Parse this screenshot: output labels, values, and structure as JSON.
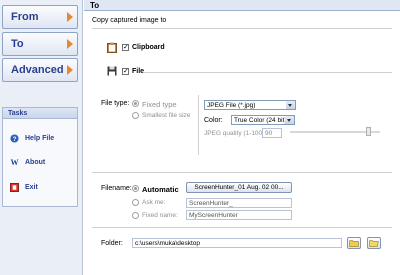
{
  "nav": {
    "from_label": "From",
    "to_label": "To",
    "advanced_label": "Advanced"
  },
  "tasks": {
    "title": "Tasks",
    "items": [
      {
        "label": "Help File",
        "icon": "help-icon"
      },
      {
        "label": "About",
        "icon": "about-icon"
      },
      {
        "label": "Exit",
        "icon": "exit-icon"
      }
    ]
  },
  "panel": {
    "title": "To",
    "subtitle": "Copy captured image to",
    "clipboard_label": "Clipboard",
    "clipboard_checked": true,
    "file_label": "File",
    "file_checked": true
  },
  "file_type": {
    "label": "File type:",
    "fixed_type_label": "Fixed type",
    "smallest_label": "Smallest file size",
    "format_value": "JPEG File (*.jpg)",
    "color_label": "Color:",
    "color_value": "True Color (24 bit)",
    "quality_label": "JPEG quality (1-100):",
    "quality_value": "90"
  },
  "filename": {
    "label": "Filename:",
    "automatic_label": "Automatic",
    "automatic_value": "ScreenHunter_01 Aug. 02 00...",
    "ask_label": "Ask me:",
    "ask_value": "ScreenHunter_",
    "fixed_label": "Fixed name:",
    "fixed_value": "MyScreenHunter"
  },
  "folder": {
    "label": "Folder:",
    "value": "c:\\users\\muka\\desktop"
  },
  "colors": {
    "nav_text": "#2a3f8f",
    "nav_arrow": "#e8872e",
    "panel_bg": "#ffffff",
    "sidebar_bg": "#e9eef7"
  }
}
